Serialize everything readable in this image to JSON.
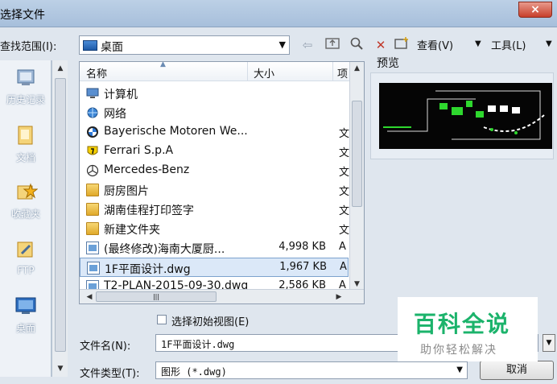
{
  "window": {
    "title": "选择文件",
    "close": "×"
  },
  "toolbar": {
    "lookin_label": "查找范围(I):",
    "location": "桌面",
    "views_label": "查看(V)",
    "tools_label": "工具(L)"
  },
  "places": [
    {
      "label": "历史记录",
      "icon": "history-icon"
    },
    {
      "label": "文档",
      "icon": "documents-icon"
    },
    {
      "label": "收藏夹",
      "icon": "favorites-icon"
    },
    {
      "label": "FTP",
      "icon": "ftp-icon"
    },
    {
      "label": "桌面",
      "icon": "desktop-icon"
    }
  ],
  "file_list": {
    "columns": {
      "name": "名称",
      "size": "大小",
      "type": "项"
    },
    "rows": [
      {
        "name": "计算机",
        "size": "",
        "type": "",
        "icon": "computer-icon"
      },
      {
        "name": "网络",
        "size": "",
        "type": "",
        "icon": "network-icon"
      },
      {
        "name": "Bayerische Motoren We...",
        "size": "",
        "type": "文",
        "icon": "bmw-logo-icon"
      },
      {
        "name": "Ferrari S.p.A",
        "size": "",
        "type": "文",
        "icon": "ferrari-logo-icon"
      },
      {
        "name": "Mercedes-Benz",
        "size": "",
        "type": "文",
        "icon": "mercedes-logo-icon"
      },
      {
        "name": "厨房图片",
        "size": "",
        "type": "文",
        "icon": "folder-icon"
      },
      {
        "name": "湖南佳程打印签字",
        "size": "",
        "type": "文",
        "icon": "folder-icon"
      },
      {
        "name": "新建文件夹",
        "size": "",
        "type": "文",
        "icon": "folder-icon"
      },
      {
        "name": "(最终修改)海南大厦厨...",
        "size": "4,998 KB",
        "type": "A",
        "icon": "dwg-file-icon"
      },
      {
        "name": "1F平面设计.dwg",
        "size": "1,967 KB",
        "type": "A",
        "icon": "dwg-file-icon",
        "selected": true
      },
      {
        "name": "T2-PLAN-2015-09-30.dwg",
        "size": "2,586 KB",
        "type": "A",
        "icon": "dwg-file-icon"
      }
    ]
  },
  "preview": {
    "label": "预览"
  },
  "options": {
    "initial_view_label": "选择初始视图(E)",
    "initial_view_checked": false
  },
  "filename": {
    "label": "文件名(N):",
    "value": "1F平面设计.dwg"
  },
  "filetype": {
    "label": "文件类型(T):",
    "value": "图形 (*.dwg)"
  },
  "buttons": {
    "cancel": "取消"
  },
  "watermark": {
    "title": "百科全说",
    "subtitle": "助你轻松解决"
  },
  "colors": {
    "accent": "#1bb36b",
    "selection": "#dbe8f8",
    "titlebar": "#a7bfdb"
  }
}
